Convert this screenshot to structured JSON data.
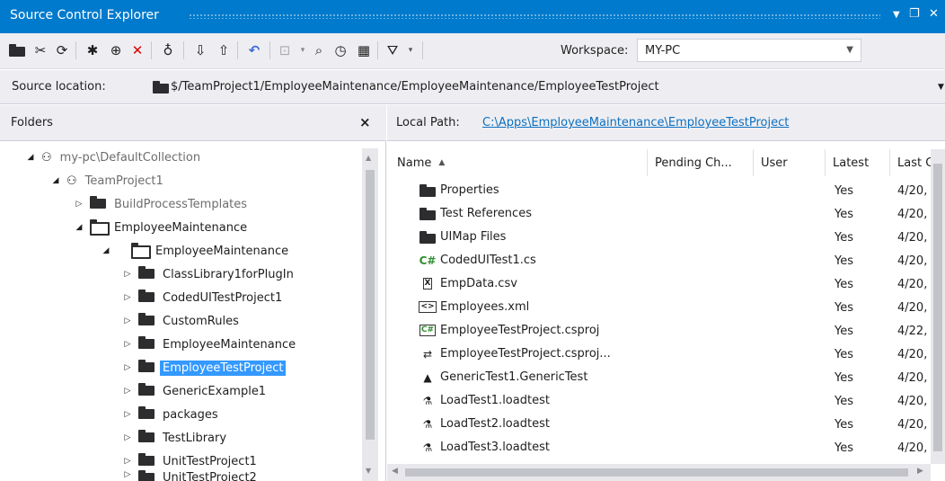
{
  "window": {
    "title": "Source Control Explorer",
    "buttons": [
      "▼",
      "❐",
      "✕"
    ]
  },
  "toolbar": {
    "workspace_label": "Workspace:",
    "workspace_value": "MY-PC"
  },
  "location": {
    "label": "Source location:",
    "path": "$/TeamProject1/EmployeeMaintenance/EmployeeMaintenance/EmployeeTestProject"
  },
  "folders_pane": {
    "title": "Folders",
    "close": "×",
    "tree": [
      {
        "label": "my-pc\\DefaultCollection",
        "icon": "collection-icon",
        "expanded": true
      },
      {
        "label": "TeamProject1",
        "icon": "team-project-icon",
        "expanded": true
      },
      {
        "label": "BuildProcessTemplates",
        "icon": "folder-icon",
        "expanded": false
      },
      {
        "label": "EmployeeMaintenance",
        "icon": "folder-open-icon",
        "expanded": true
      },
      {
        "label": "EmployeeMaintenance",
        "icon": "folder-open-icon",
        "expanded": true
      },
      {
        "label": "ClassLibrary1forPlugIn",
        "icon": "folder-icon",
        "expanded": false
      },
      {
        "label": "CodedUITestProject1",
        "icon": "folder-icon",
        "expanded": false
      },
      {
        "label": "CustomRules",
        "icon": "folder-icon",
        "expanded": false
      },
      {
        "label": "EmployeeMaintenance",
        "icon": "folder-icon",
        "expanded": false
      },
      {
        "label": "EmployeeTestProject",
        "icon": "folder-icon",
        "expanded": false,
        "selected": true
      },
      {
        "label": "GenericExample1",
        "icon": "folder-icon",
        "expanded": false
      },
      {
        "label": "packages",
        "icon": "folder-icon",
        "expanded": false
      },
      {
        "label": "TestLibrary",
        "icon": "folder-icon",
        "expanded": false
      },
      {
        "label": "UnitTestProject1",
        "icon": "folder-icon",
        "expanded": false
      },
      {
        "label": "UnitTestProject2",
        "icon": "folder-icon",
        "expanded": false
      }
    ]
  },
  "files_pane": {
    "local_path_label": "Local Path:",
    "local_path": "C:\\Apps\\EmployeeMaintenance\\EmployeeTestProject",
    "columns": [
      "Name",
      "Pending Ch...",
      "User",
      "Latest",
      "Last C"
    ],
    "rows": [
      {
        "name": "Properties",
        "icon": "folder-icon",
        "latest": "Yes",
        "last": "4/20,"
      },
      {
        "name": "Test References",
        "icon": "folder-icon",
        "latest": "Yes",
        "last": "4/20,"
      },
      {
        "name": "UIMap Files",
        "icon": "folder-icon",
        "latest": "Yes",
        "last": "4/20,"
      },
      {
        "name": "CodedUITest1.cs",
        "icon": "csharp-file-icon",
        "latest": "Yes",
        "last": "4/20,"
      },
      {
        "name": "EmpData.csv",
        "icon": "csv-file-icon",
        "latest": "Yes",
        "last": "4/20,"
      },
      {
        "name": "Employees.xml",
        "icon": "xml-file-icon",
        "latest": "Yes",
        "last": "4/20,"
      },
      {
        "name": "EmployeeTestProject.csproj",
        "icon": "csproj-file-icon",
        "latest": "Yes",
        "last": "4/22,"
      },
      {
        "name": "EmployeeTestProject.csproj...",
        "icon": "vspscc-file-icon",
        "latest": "Yes",
        "last": "4/20,"
      },
      {
        "name": "GenericTest1.GenericTest",
        "icon": "generic-test-icon",
        "latest": "Yes",
        "last": "4/20,"
      },
      {
        "name": "LoadTest1.loadtest",
        "icon": "load-test-icon",
        "latest": "Yes",
        "last": "4/20,"
      },
      {
        "name": "LoadTest2.loadtest",
        "icon": "load-test-icon",
        "latest": "Yes",
        "last": "4/20,"
      },
      {
        "name": "LoadTest3.loadtest",
        "icon": "load-test-icon",
        "latest": "Yes",
        "last": "4/20,"
      }
    ]
  },
  "colors": {
    "titlebar": "#007acc",
    "selection": "#3399ff",
    "link": "#0e70c0",
    "toolbar_bg": "#eeeef2"
  }
}
